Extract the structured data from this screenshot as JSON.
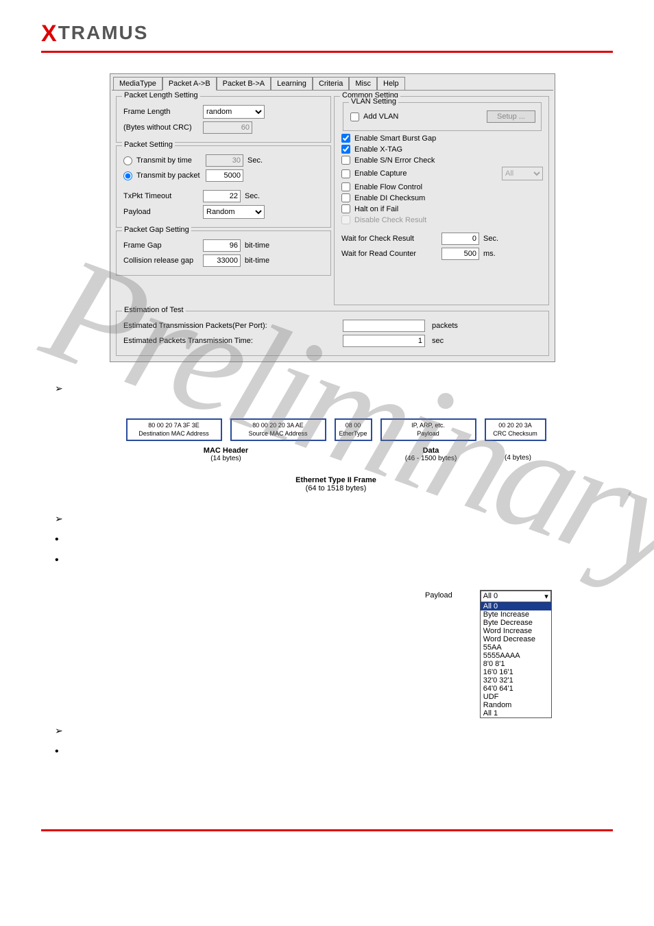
{
  "logo": {
    "prefix": "X",
    "rest": "TRAMUS"
  },
  "tabs": [
    "MediaType",
    "Packet A->B",
    "Packet B->A",
    "Learning",
    "Criteria",
    "Misc",
    "Help"
  ],
  "active_tab_index": 1,
  "groups": {
    "pkt_len": {
      "legend": "Packet Length Setting",
      "frame_length_lbl": "Frame Length",
      "frame_length_val": "random",
      "bytes_note": "(Bytes without CRC)",
      "bytes_val": "60"
    },
    "pkt_set": {
      "legend": "Packet Setting",
      "transmit_time_lbl": "Transmit by time",
      "transmit_time_val": "30",
      "transmit_time_unit": "Sec.",
      "transmit_pkt_lbl": "Transmit by packet",
      "transmit_pkt_val": "5000",
      "txpkt_timeout_lbl": "TxPkt Timeout",
      "txpkt_timeout_val": "22",
      "txpkt_timeout_unit": "Sec.",
      "payload_lbl": "Payload",
      "payload_val": "Random"
    },
    "pkt_gap": {
      "legend": "Packet Gap Setting",
      "frame_gap_lbl": "Frame Gap",
      "frame_gap_val": "96",
      "frame_gap_unit": "bit-time",
      "collision_lbl": "Collision release gap",
      "collision_val": "33000",
      "collision_unit": "bit-time"
    },
    "common": {
      "legend": "Common Setting",
      "vlan_legend": "VLAN Setting",
      "add_vlan_lbl": "Add VLAN",
      "setup_btn": "Setup ...",
      "enable_smart_burst": "Enable Smart Burst Gap",
      "enable_xtag": "Enable X-TAG",
      "enable_sn": "Enable S/N Error Check",
      "enable_capture": "Enable Capture",
      "capture_opt": "All",
      "enable_flow": "Enable Flow Control",
      "enable_di": "Enable DI Checksum",
      "halt_fail": "Halt on if Fail",
      "disable_check": "Disable Check Result",
      "wait_check_lbl": "Wait for Check Result",
      "wait_check_val": "0",
      "wait_check_unit": "Sec.",
      "wait_read_lbl": "Wait for Read Counter",
      "wait_read_val": "500",
      "wait_read_unit": "ms."
    },
    "estimation": {
      "legend": "Estimation of Test",
      "est_tx_lbl": "Estimated Transmission Packets(Per Port):",
      "est_tx_val": "",
      "est_tx_unit": "packets",
      "est_time_lbl": "Estimated Packets Transmission Time:",
      "est_time_val": "1",
      "est_time_unit": "sec"
    }
  },
  "frame": {
    "dest": {
      "hex": "80 00 20 7A 3F 3E",
      "name": "Destination MAC Address"
    },
    "src": {
      "hex": "80 00 20 20 3A AE",
      "name": "Source MAC Address"
    },
    "eth": {
      "hex": "08 00",
      "name": "EtherType"
    },
    "payload": {
      "hex": "IP, ARP, etc.",
      "name": "Payload"
    },
    "crc": {
      "hex": "00 20 20 3A",
      "name": "CRC Checksum"
    },
    "mac_hdr": {
      "title": "MAC Header",
      "sub": "(14 bytes)"
    },
    "data_lbl": {
      "title": "Data",
      "sub": "(46 - 1500 bytes)"
    },
    "crc_lbl": {
      "sub": "(4 bytes)"
    },
    "total": {
      "title": "Ethernet Type II Frame",
      "sub": "(64 to 1518 bytes)"
    }
  },
  "payload_dd": {
    "label": "Payload",
    "selected": "All 0",
    "options": [
      "All 0",
      "Byte Increase",
      "Byte Decrease",
      "Word Increase",
      "Word Decrease",
      "55AA",
      "5555AAAA",
      "8'0 8'1",
      "16'0 16'1",
      "32'0 32'1",
      "64'0 64'1",
      "UDF",
      "Random",
      "All 1"
    ]
  },
  "watermark": "Preliminary"
}
